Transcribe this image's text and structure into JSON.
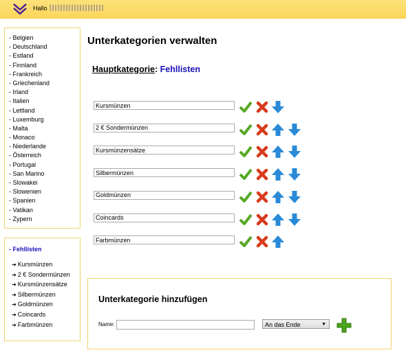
{
  "header": {
    "greeting": "Hallo",
    "logo_icon": "double-chevron-down-logo"
  },
  "countries": [
    "- Belgien",
    "- Deutschland",
    "- Estland",
    "- Finnland",
    "- Frankreich",
    "- Griechenland",
    "- Irland",
    "- Italien",
    "- Lettland",
    "- Luxemburg",
    "- Malta",
    "- Monaco",
    "- Niederlande",
    "- Österreich",
    "- Portugal",
    "- San Marino",
    "- Slowakei",
    "- Slowenien",
    "- Spanien",
    "- Vatikan",
    "- Zypern"
  ],
  "sidebar_sub": {
    "heading": "- Fehllisten",
    "items": [
      "Kursmünzen",
      "2 € Sondermünzen",
      "Kursmünzensätze",
      "Silbermünzen",
      "Goldmünzen",
      "Coincards",
      "Farbmünzen"
    ]
  },
  "page_title": "Unterkategorien verwalten",
  "main_category": {
    "label": "Hauptkategorie",
    "separator": ":",
    "value": "Fehllisten"
  },
  "rows": [
    {
      "value": "Kursmünzen",
      "up": false,
      "down": true
    },
    {
      "value": "2 € Sondermünzen",
      "up": true,
      "down": true
    },
    {
      "value": "Kursmünzensätze",
      "up": true,
      "down": true
    },
    {
      "value": "Silbermünzen",
      "up": true,
      "down": true
    },
    {
      "value": "Goldmünzen",
      "up": true,
      "down": true
    },
    {
      "value": "Coincards",
      "up": true,
      "down": true
    },
    {
      "value": "Farbmünzen",
      "up": true,
      "down": false
    }
  ],
  "add": {
    "title": "Unterkategorie hinzufügen",
    "name_label": "Name:",
    "name_value": "",
    "position_selected": "An das Ende"
  },
  "colors": {
    "accent_blue": "#1a10b8",
    "border_yellow": "#f1d36e",
    "check_green": "#55a822",
    "delete_red": "#d83a1c",
    "arrow_blue": "#2a8ad8"
  }
}
